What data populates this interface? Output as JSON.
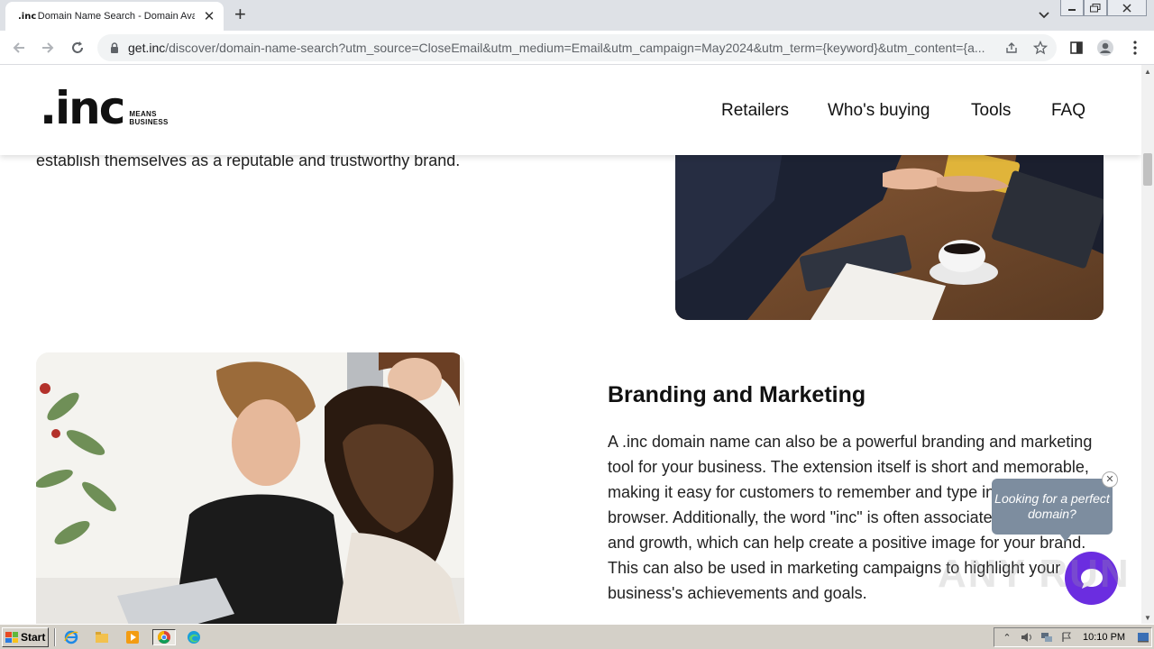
{
  "browser": {
    "tab": {
      "favicon_text": ".inc",
      "title": "Domain Name Search - Domain Avail"
    },
    "url": {
      "host": "get.inc",
      "path": "/discover/domain-name-search?utm_source=CloseEmail&utm_medium=Email&utm_campaign=May2024&utm_term={keyword}&utm_content={a..."
    }
  },
  "site": {
    "logo": {
      "mark": ".inc",
      "tagline_line1": "MEANS",
      "tagline_line2": "BUSINESS"
    },
    "nav": [
      "Retailers",
      "Who's buying",
      "Tools",
      "FAQ"
    ]
  },
  "content": {
    "top_paragraph_tail": "establish themselves as a reputable and trustworthy brand.",
    "section": {
      "title": "Branding and Marketing",
      "body": "A .inc domain name can also be a powerful branding and marketing tool for your business. The extension itself is short and memorable, making it easy for customers to remember and type into their browser. Additionally, the word \"inc\" is often associated with success and growth, which can help create a positive image for your brand. This can also be used in marketing campaigns to highlight your business's achievements and goals."
    }
  },
  "chat": {
    "prompt": "Looking for a perfect domain?"
  },
  "watermark": "ANY RUN",
  "taskbar": {
    "start_label": "Start",
    "clock": "10:10 PM"
  },
  "colors": {
    "brand_purple": "#6b2de0",
    "chat_bubble": "#7d8d9f",
    "text": "#222222"
  }
}
